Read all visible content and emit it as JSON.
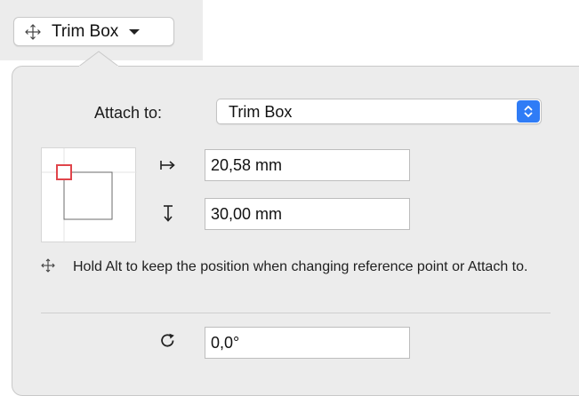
{
  "trigger": {
    "label": "Trim Box",
    "icon": "move-crosshair-icon"
  },
  "form": {
    "attach_label": "Attach to:",
    "attach_value": "Trim Box",
    "reference_point": "top-left",
    "x_icon": "horizontal-offset-arrow-icon",
    "x_value": "20,58 mm",
    "y_icon": "vertical-offset-arrow-icon",
    "y_value": "30,00 mm",
    "rotation_icon": "rotate-clockwise-icon",
    "rotation_value": "0,0°"
  },
  "hint": {
    "icon": "move-crosshair-icon",
    "text": "Hold Alt to keep the position when changing reference point or Attach to."
  },
  "colors": {
    "accent": "#2f7cf6",
    "reference_marker": "#e0454b",
    "panel_background": "#ececec"
  }
}
